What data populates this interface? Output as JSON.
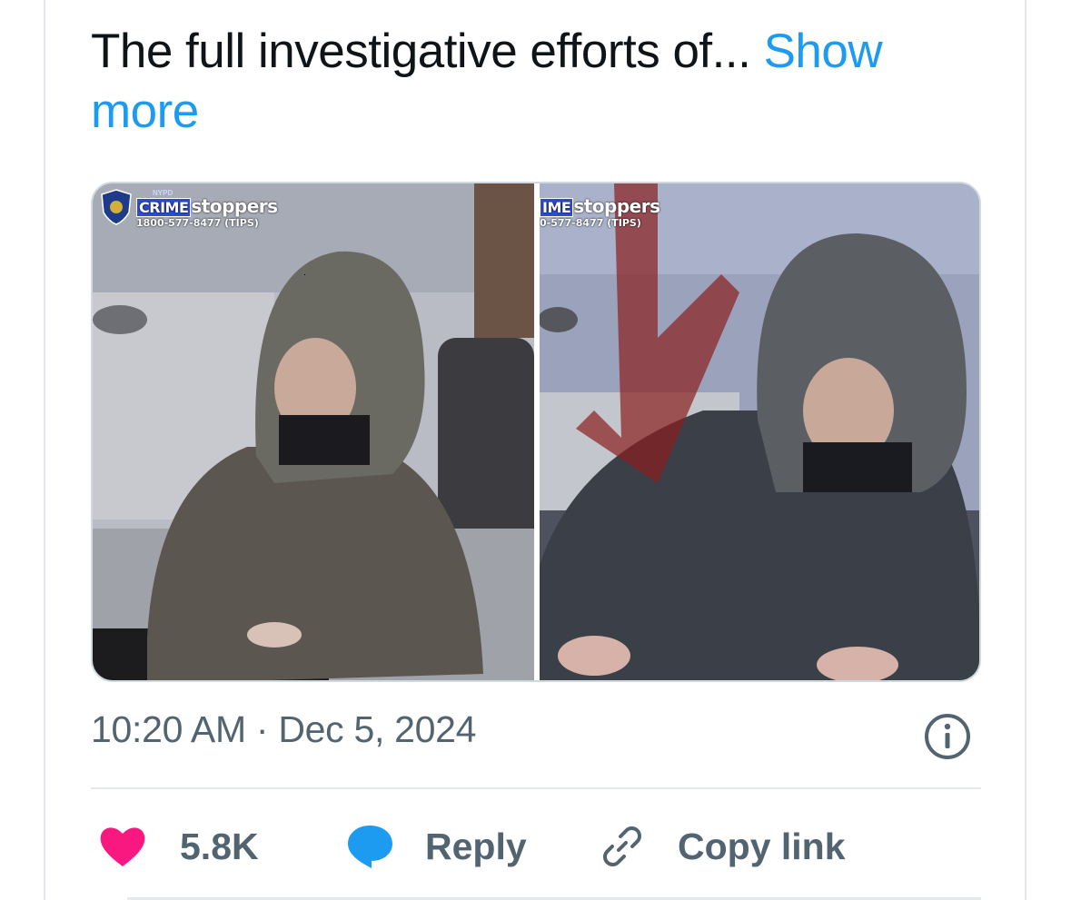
{
  "tweet": {
    "text": "The full investigative efforts of...",
    "show_more": "Show more",
    "timestamp": "10:20 AM · Dec 5, 2024"
  },
  "media": {
    "left_overlay": {
      "nypd": "NYPD",
      "brand_prefix": "CRIME",
      "brand_suffix": "stoppers",
      "phone": "1800-577-8477 (TIPS)"
    },
    "right_overlay": {
      "brand_prefix": "IME",
      "brand_suffix": "stoppers",
      "phone": "0-577-8477 (TIPS)"
    }
  },
  "actions": {
    "likes": "5.8K",
    "reply": "Reply",
    "copy_link": "Copy link"
  },
  "colors": {
    "accent": "#1d9bf0",
    "like": "#f91880",
    "muted": "#536471",
    "text": "#0f1419"
  },
  "icons": [
    "heart-icon",
    "reply-bubble-icon",
    "link-icon",
    "info-icon"
  ]
}
